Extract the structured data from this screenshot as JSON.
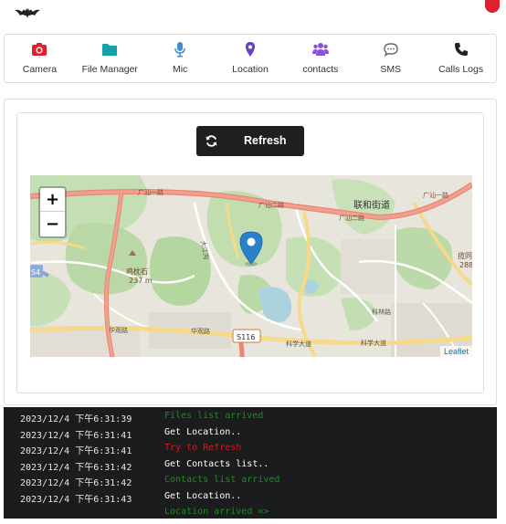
{
  "colors": {
    "camera": "#e0202a",
    "files": "#17a2a8",
    "mic": "#3c8fd6",
    "location": "#6a3fc2",
    "contacts": "#8b52d8",
    "sms": "#666666",
    "calls": "#222222",
    "log_ok": "#1e8a1e",
    "log_err": "#e01414",
    "log_info": "#ffffff"
  },
  "toolbar": {
    "items": [
      {
        "label": "Camera",
        "icon": "camera-icon"
      },
      {
        "label": "File Manager",
        "icon": "folder-icon"
      },
      {
        "label": "Mic",
        "icon": "microphone-icon"
      },
      {
        "label": "Location",
        "icon": "map-marker-icon"
      },
      {
        "label": "contacts",
        "icon": "users-icon"
      },
      {
        "label": "SMS",
        "icon": "comment-icon"
      },
      {
        "label": "Calls Logs",
        "icon": "phone-icon"
      }
    ]
  },
  "refresh": {
    "label": "Refresh"
  },
  "map": {
    "labels": {
      "road_guangshan_yi": "广汕一路",
      "road_guangshan_er_1": "广汕二路",
      "road_guangshan_er_2": "广汕二路",
      "road_guangshan_yi_2": "广汕一路",
      "district": "联和街道",
      "ditch": "大江沟",
      "road_hua_guan_1": "华观路",
      "road_hua_guan_2": "华观路",
      "road_sci": "科学大道",
      "road_sci_2": "科学大道",
      "road_kelin": "科林路",
      "peak_name": "鸡枕石",
      "peak_height": "237 m",
      "route_s116": "S116",
      "route_s4": "S4",
      "hill_right": "揽同",
      "hill_right_h": "288"
    },
    "zoom_in": "+",
    "zoom_out": "−",
    "attribution": "Leaflet"
  },
  "log": [
    {
      "time": "2023/12/4 下午6:31:39",
      "msg": "Files list arrived",
      "kind": "ok"
    },
    {
      "time": "2023/12/4 下午6:31:41",
      "msg": "Get Location..",
      "kind": "info"
    },
    {
      "time": "2023/12/4 下午6:31:41",
      "msg": "Try to Refresh",
      "kind": "err"
    },
    {
      "time": "2023/12/4 下午6:31:42",
      "msg": "Get Contacts list..",
      "kind": "info"
    },
    {
      "time": "2023/12/4 下午6:31:42",
      "msg": "Contacts list arrived",
      "kind": "ok"
    },
    {
      "time": "2023/12/4 下午6:31:43",
      "msg": "Get Location..",
      "kind": "info"
    },
    {
      "time": "",
      "msg": "Location arrived =>",
      "kind": "ok"
    }
  ]
}
